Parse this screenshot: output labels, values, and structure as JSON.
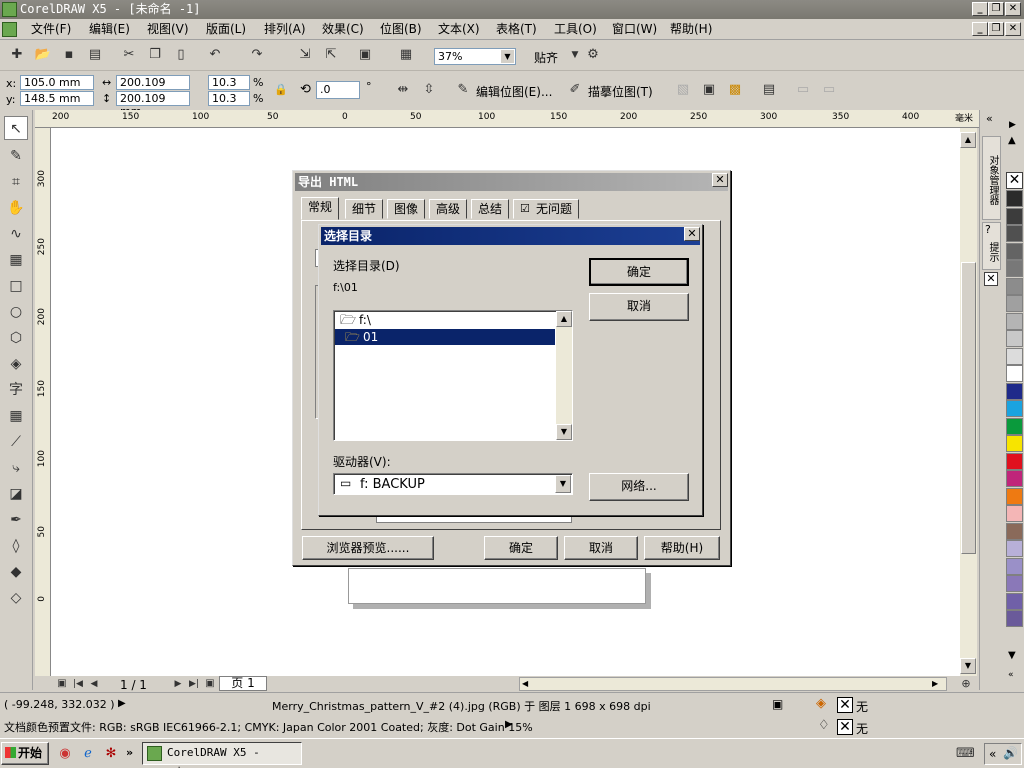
{
  "app": {
    "title": "CorelDRAW X5 - [未命名 -1]"
  },
  "menu": [
    "文件(F)",
    "编辑(E)",
    "视图(V)",
    "版面(L)",
    "排列(A)",
    "效果(C)",
    "位图(B)",
    "文本(X)",
    "表格(T)",
    "工具(O)",
    "窗口(W)",
    "帮助(H)"
  ],
  "toolbar": {
    "zoom": "37%",
    "snap_label": "贴齐"
  },
  "props": {
    "x_label": "x:",
    "x": "105.0 mm",
    "y_label": "y:",
    "y": "148.5 mm",
    "w": "200.109 mm",
    "h": "200.109 mm",
    "sx": "10.3",
    "sy": "10.3",
    "pct": "%",
    "angle": ".0",
    "deg": "°",
    "edit_bitmap": "编辑位图(E)...",
    "trace_bitmap": "描摹位图(T)"
  },
  "ruler": {
    "units": "毫米",
    "h_ticks": [
      "200",
      "150",
      "100",
      "50",
      "0",
      "50",
      "100",
      "150",
      "200",
      "250",
      "300",
      "350",
      "400"
    ],
    "v_ticks": [
      "300",
      "250",
      "200",
      "150",
      "100",
      "50",
      "0"
    ]
  },
  "docker": {
    "obj_manager": "对象管理器",
    "hints": "提示"
  },
  "palette": {
    "colors": [
      "#2b2b2b",
      "#3c3c3c",
      "#505050",
      "#646464",
      "#787878",
      "#8c8c8c",
      "#a0a0a0",
      "#b4b4b4",
      "#c8c8c8",
      "#dcdcdc",
      "#ffffff",
      "#1f2a8a",
      "#1aa3e0",
      "#0a9a3c",
      "#f7e400",
      "#e0101e",
      "#c0257a",
      "#ee7a12",
      "#f4b6b6",
      "#8a6a5a",
      "#b8b0d8",
      "#9a90c8",
      "#8a78b8",
      "#7060a8",
      "#6a5a9a"
    ]
  },
  "pager": {
    "count": "1 / 1",
    "tab": "页 1"
  },
  "status": {
    "coords": "( -99.248, 332.032 )",
    "file_info": "Merry_Christmas_pattern_V_#2 (4).jpg (RGB) 于 图层 1 698 x 698 dpi",
    "profile": "文档颜色预置文件: RGB: sRGB IEC61966-2.1; CMYK: Japan Color 2001 Coated; 灰度: Dot Gain 15%",
    "fill_none": "无",
    "outline_none": "无"
  },
  "taskbar": {
    "start": "开始",
    "task": "CorelDRAW X5 - [未..."
  },
  "export_dialog": {
    "title": "导出 HTML",
    "tabs": [
      "常规",
      "细节",
      "图像",
      "高级",
      "总结",
      "无问题"
    ],
    "browser_preview": "浏览器预览......",
    "ok": "确定",
    "cancel": "取消",
    "help": "帮助(H)"
  },
  "dir_dialog": {
    "title": "选择目录",
    "label": "选择目录(D)",
    "path": "f:\\01",
    "tree": [
      "f:\\",
      "01"
    ],
    "drive_label": "驱动器(V):",
    "drive": "f: BACKUP",
    "ok": "确定",
    "cancel": "取消",
    "network": "网络..."
  }
}
